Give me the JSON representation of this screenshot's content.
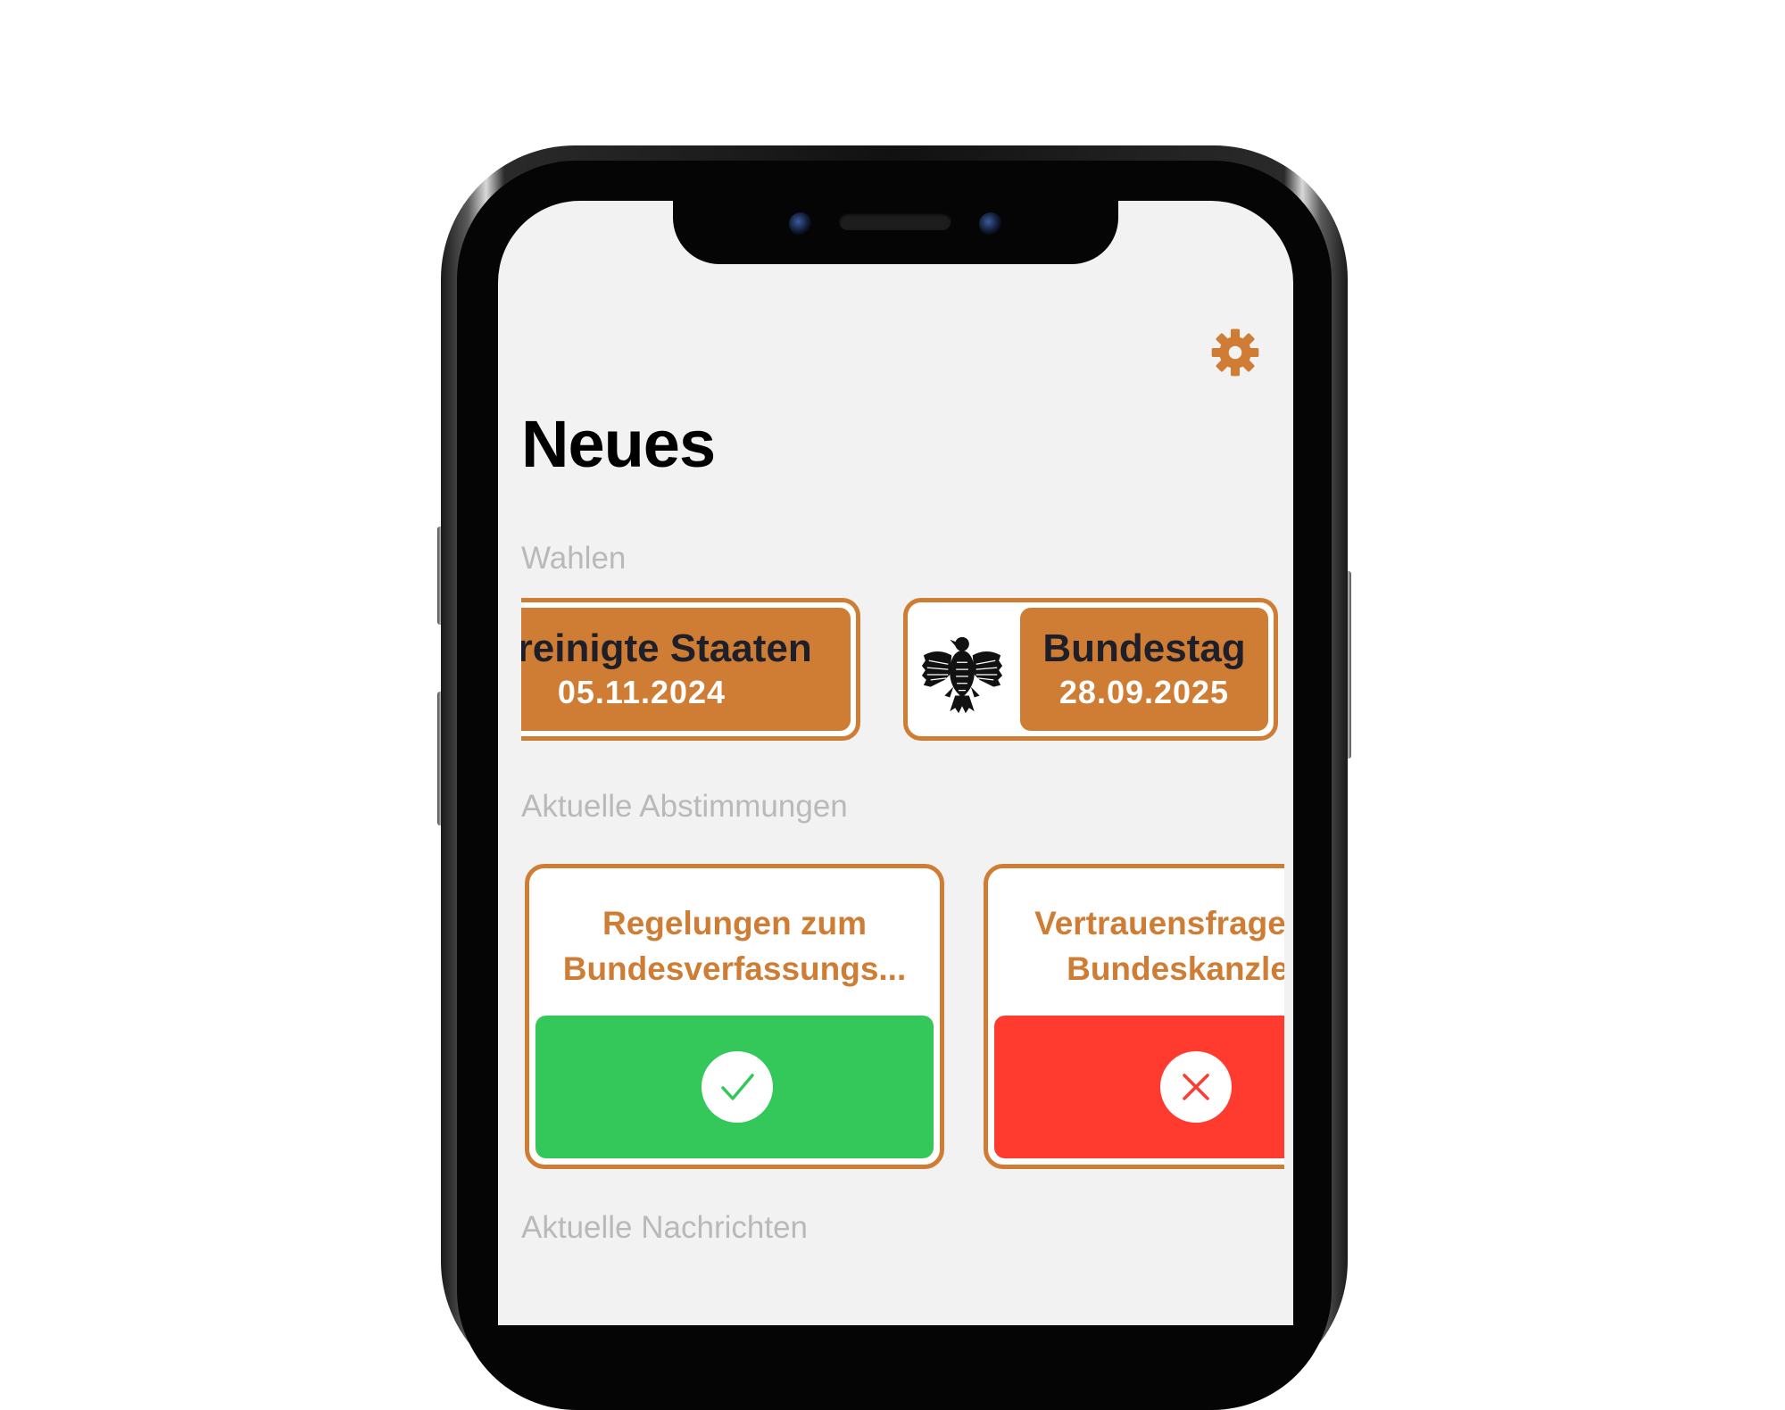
{
  "header": {
    "settings_icon": "gear-icon",
    "title": "Neues"
  },
  "sections": {
    "elections": "Wahlen",
    "votes": "Aktuelle Abstimmungen",
    "news": "Aktuelle Nachrichten"
  },
  "elections": [
    {
      "name": "Vereinigte Staaten",
      "date": "05.11.2024"
    },
    {
      "name": "Bundestag",
      "date": "28.09.2025",
      "icon": "federal-eagle-icon"
    }
  ],
  "votes": [
    {
      "title": "Regelungen zum Bundesverfassungs...",
      "result": "accepted",
      "icon": "checkmark-icon"
    },
    {
      "title": "Vertrauensfrage des Bundeskanzlers",
      "result": "rejected",
      "icon": "cross-icon"
    }
  ],
  "colors": {
    "accent": "#cf7d34",
    "background": "#f2f2f2",
    "accepted": "#34c759",
    "rejected": "#ff3b30",
    "section_label": "#b9b9b9"
  }
}
